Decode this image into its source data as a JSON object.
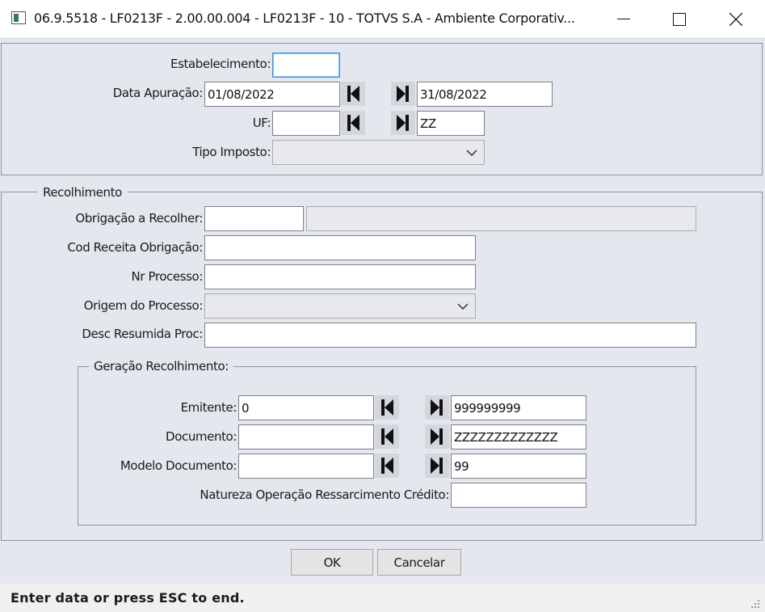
{
  "window": {
    "title": "06.9.5518 - LF0213F - 2.00.00.004 - LF0213F - 10 - TOTVS S.A - Ambiente Corporativ...",
    "minimize_icon": "minimize-icon",
    "maximize_icon": "maximize-icon",
    "close_icon": "close-icon"
  },
  "filters": {
    "estabelecimento_label": "Estabelecimento:",
    "estabelecimento_value": "",
    "data_apuracao_label": "Data Apuração:",
    "data_apuracao_from": "01/08/2022",
    "data_apuracao_to": "31/08/2022",
    "uf_label": "UF:",
    "uf_from": "",
    "uf_to": "ZZ",
    "tipo_imposto_label": "Tipo Imposto:",
    "tipo_imposto_value": ""
  },
  "recolhimento": {
    "legend": "Recolhimento",
    "obrigacao_label": "Obrigação a Recolher:",
    "obrigacao_value": "",
    "obrigacao_desc": "",
    "cod_receita_label": "Cod Receita Obrigação:",
    "cod_receita_value": "",
    "nr_processo_label": "Nr Processo:",
    "nr_processo_value": "",
    "origem_label": "Origem do Processo:",
    "origem_value": "",
    "desc_resumida_label": "Desc Resumida Proc:",
    "desc_resumida_value": ""
  },
  "geracao": {
    "legend": "Geração Recolhimento:",
    "emitente_label": "Emitente:",
    "emitente_from": "0",
    "emitente_to": "999999999",
    "documento_label": "Documento:",
    "documento_from": "",
    "documento_to": "ZZZZZZZZZZZZZ",
    "modelo_label": "Modelo Documento:",
    "modelo_from": "",
    "modelo_to": "99",
    "natureza_label": "Natureza Operação Ressarcimento Crédito:",
    "natureza_value": ""
  },
  "actions": {
    "ok_label": "OK",
    "cancel_label": "Cancelar"
  },
  "status": {
    "message": "Enter data or press ESC to end."
  }
}
